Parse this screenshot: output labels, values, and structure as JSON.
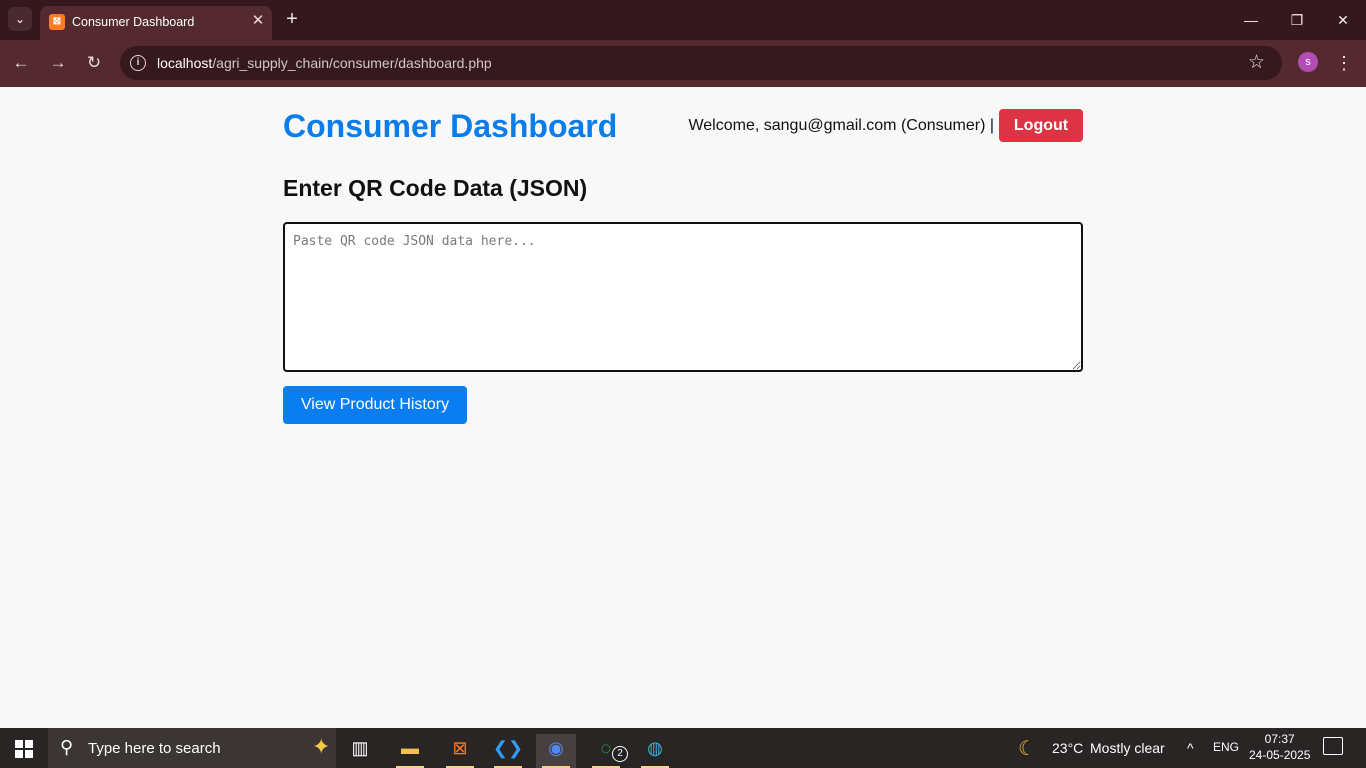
{
  "browser": {
    "tab_title": "Consumer Dashboard",
    "url_host": "localhost",
    "url_path": "/agri_supply_chain/consumer/dashboard.php",
    "profile_initial": "s"
  },
  "page": {
    "title": "Consumer Dashboard",
    "welcome": "Welcome, sangu@gmail.com (Consumer) |",
    "logout_label": "Logout",
    "section_title": "Enter QR Code Data (JSON)",
    "qr_placeholder": "Paste QR code JSON data here...",
    "submit_label": "View Product History"
  },
  "taskbar": {
    "search_placeholder": "Type here to search",
    "weather_temp": "23°C",
    "weather_desc": "Mostly clear",
    "language": "ENG",
    "time": "07:37",
    "date": "24-05-2025",
    "whatsapp_badge": "2"
  }
}
